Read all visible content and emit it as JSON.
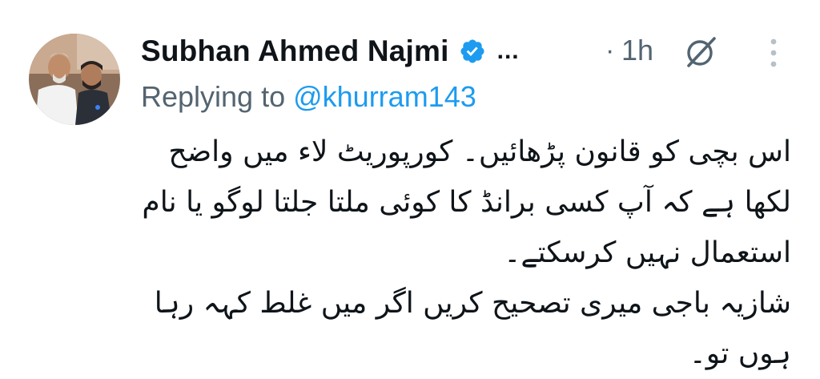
{
  "author": {
    "name": "Subhan Ahmed Najmi",
    "verified_icon": "verified-badge-icon",
    "ellipsis": "...",
    "separator": "·",
    "time": "1h"
  },
  "reply": {
    "prefix": "Replying to ",
    "handle": "@khurram143"
  },
  "tweet": {
    "text": "اس بچی کو قانون پڑھائیں۔ کورپوریٹ لاء میں واضح\nلکھا ہے کہ آپ کسی برانڈ کا کوئی ملتا جلتا لوگو یا نام\nاستعمال نہیں کرسکتے۔\nشازیہ باجی میری تصحیح کریں اگر میں غلط کہہ رہا\nہوں تو۔"
  },
  "colors": {
    "text": "#0f1419",
    "secondary": "#536471",
    "accent": "#1d9bf0"
  },
  "icons": [
    "avatar",
    "verified-badge-icon",
    "grok-icon",
    "more-vertical-icon"
  ]
}
